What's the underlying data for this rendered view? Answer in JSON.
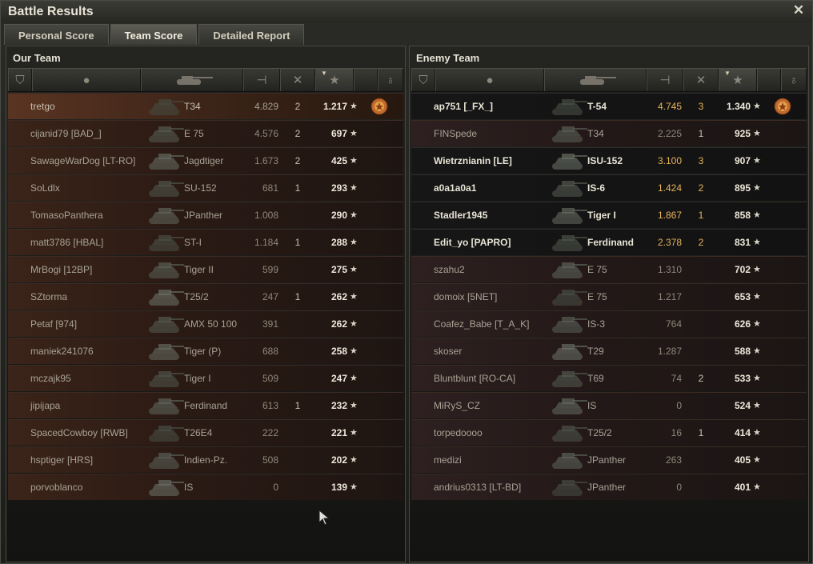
{
  "window": {
    "title": "Battle Results"
  },
  "tabs": [
    {
      "label": "Personal Score",
      "active": false
    },
    {
      "label": "Team Score",
      "active": true
    },
    {
      "label": "Detailed Report",
      "active": false
    }
  ],
  "our_team": {
    "title": "Our Team",
    "rows": [
      {
        "name": "tretgo",
        "vehicle": "T34",
        "damage": "4.829",
        "kills": "2",
        "xp": "1.217",
        "medal": true,
        "style": "self"
      },
      {
        "name": "cijanid79 [BAD_]",
        "vehicle": "E 75",
        "damage": "4.576",
        "kills": "2",
        "xp": "697",
        "medal": false,
        "style": "dead"
      },
      {
        "name": "SawageWarDog [LT-RO]",
        "vehicle": "Jagdtiger",
        "damage": "1.673",
        "kills": "2",
        "xp": "425",
        "medal": false,
        "style": "dead"
      },
      {
        "name": "SoLdlx",
        "vehicle": "SU-152",
        "damage": "681",
        "kills": "1",
        "xp": "293",
        "medal": false,
        "style": "dead"
      },
      {
        "name": "TomasoPanthera",
        "vehicle": "JPanther",
        "damage": "1.008",
        "kills": "",
        "xp": "290",
        "medal": false,
        "style": "dead"
      },
      {
        "name": "matt3786 [HBAL]",
        "vehicle": "ST-I",
        "damage": "1.184",
        "kills": "1",
        "xp": "288",
        "medal": false,
        "style": "dead"
      },
      {
        "name": "MrBogi [12BP]",
        "vehicle": "Tiger II",
        "damage": "599",
        "kills": "",
        "xp": "275",
        "medal": false,
        "style": "dead"
      },
      {
        "name": "SZtorma",
        "vehicle": "T25/2",
        "damage": "247",
        "kills": "1",
        "xp": "262",
        "medal": false,
        "style": "dead"
      },
      {
        "name": "Petaf [974]",
        "vehicle": "AMX 50 100",
        "damage": "391",
        "kills": "",
        "xp": "262",
        "medal": false,
        "style": "dead"
      },
      {
        "name": "maniek241076",
        "vehicle": "Tiger (P)",
        "damage": "688",
        "kills": "",
        "xp": "258",
        "medal": false,
        "style": "dead"
      },
      {
        "name": "mczajk95",
        "vehicle": "Tiger I",
        "damage": "509",
        "kills": "",
        "xp": "247",
        "medal": false,
        "style": "dead"
      },
      {
        "name": "jipijapa",
        "vehicle": "Ferdinand",
        "damage": "613",
        "kills": "1",
        "xp": "232",
        "medal": false,
        "style": "dead"
      },
      {
        "name": "SpacedCowboy [RWB]",
        "vehicle": "T26E4",
        "damage": "222",
        "kills": "",
        "xp": "221",
        "medal": false,
        "style": "dead"
      },
      {
        "name": "hsptiger [HRS]",
        "vehicle": "Indien-Pz.",
        "damage": "508",
        "kills": "",
        "xp": "202",
        "medal": false,
        "style": "dead"
      },
      {
        "name": "porvoblanco",
        "vehicle": "IS",
        "damage": "0",
        "kills": "",
        "xp": "139",
        "medal": false,
        "style": "dead"
      }
    ]
  },
  "enemy_team": {
    "title": "Enemy Team",
    "rows": [
      {
        "name": "ap751 [_FX_]",
        "vehicle": "T-54",
        "damage": "4.745",
        "kills": "3",
        "xp": "1.340",
        "medal": true,
        "style": "alive"
      },
      {
        "name": "FINSpede",
        "vehicle": "T34",
        "damage": "2.225",
        "kills": "1",
        "xp": "925",
        "medal": false,
        "style": "enemy"
      },
      {
        "name": "Wietrznianin [LE]",
        "vehicle": "ISU-152",
        "damage": "3.100",
        "kills": "3",
        "xp": "907",
        "medal": false,
        "style": "alive"
      },
      {
        "name": "a0a1a0a1",
        "vehicle": "IS-6",
        "damage": "1.424",
        "kills": "2",
        "xp": "895",
        "medal": false,
        "style": "alive"
      },
      {
        "name": "Stadler1945",
        "vehicle": "Tiger I",
        "damage": "1.867",
        "kills": "1",
        "xp": "858",
        "medal": false,
        "style": "alive"
      },
      {
        "name": "Edit_yo [PAPRO]",
        "vehicle": "Ferdinand",
        "damage": "2.378",
        "kills": "2",
        "xp": "831",
        "medal": false,
        "style": "alive"
      },
      {
        "name": "szahu2",
        "vehicle": "E 75",
        "damage": "1.310",
        "kills": "",
        "xp": "702",
        "medal": false,
        "style": "enemy"
      },
      {
        "name": "domoix [5NET]",
        "vehicle": "E 75",
        "damage": "1.217",
        "kills": "",
        "xp": "653",
        "medal": false,
        "style": "enemy"
      },
      {
        "name": "Coafez_Babe [T_A_K]",
        "vehicle": "IS-3",
        "damage": "764",
        "kills": "",
        "xp": "626",
        "medal": false,
        "style": "enemy"
      },
      {
        "name": "skoser",
        "vehicle": "T29",
        "damage": "1.287",
        "kills": "",
        "xp": "588",
        "medal": false,
        "style": "enemy"
      },
      {
        "name": "Bluntblunt [RO-CA]",
        "vehicle": "T69",
        "damage": "74",
        "kills": "2",
        "xp": "533",
        "medal": false,
        "style": "enemy"
      },
      {
        "name": "MiRyS_CZ",
        "vehicle": "IS",
        "damage": "0",
        "kills": "",
        "xp": "524",
        "medal": false,
        "style": "enemy"
      },
      {
        "name": "torpedoooo",
        "vehicle": "T25/2",
        "damage": "16",
        "kills": "1",
        "xp": "414",
        "medal": false,
        "style": "enemy"
      },
      {
        "name": "medizi",
        "vehicle": "JPanther",
        "damage": "263",
        "kills": "",
        "xp": "405",
        "medal": false,
        "style": "enemy"
      },
      {
        "name": "andrius0313 [LT-BD]",
        "vehicle": "JPanther",
        "damage": "0",
        "kills": "",
        "xp": "401",
        "medal": false,
        "style": "enemy"
      }
    ]
  },
  "header_icons": [
    "squad-icon",
    "player-icon",
    "vehicle-icon",
    "damage-icon",
    "kills-icon",
    "xp-star-icon",
    "medal-icon"
  ],
  "colors": {
    "alive_stat": "#e6b35a",
    "self_row": "#5a3422",
    "dead_row": "#3b2419"
  }
}
